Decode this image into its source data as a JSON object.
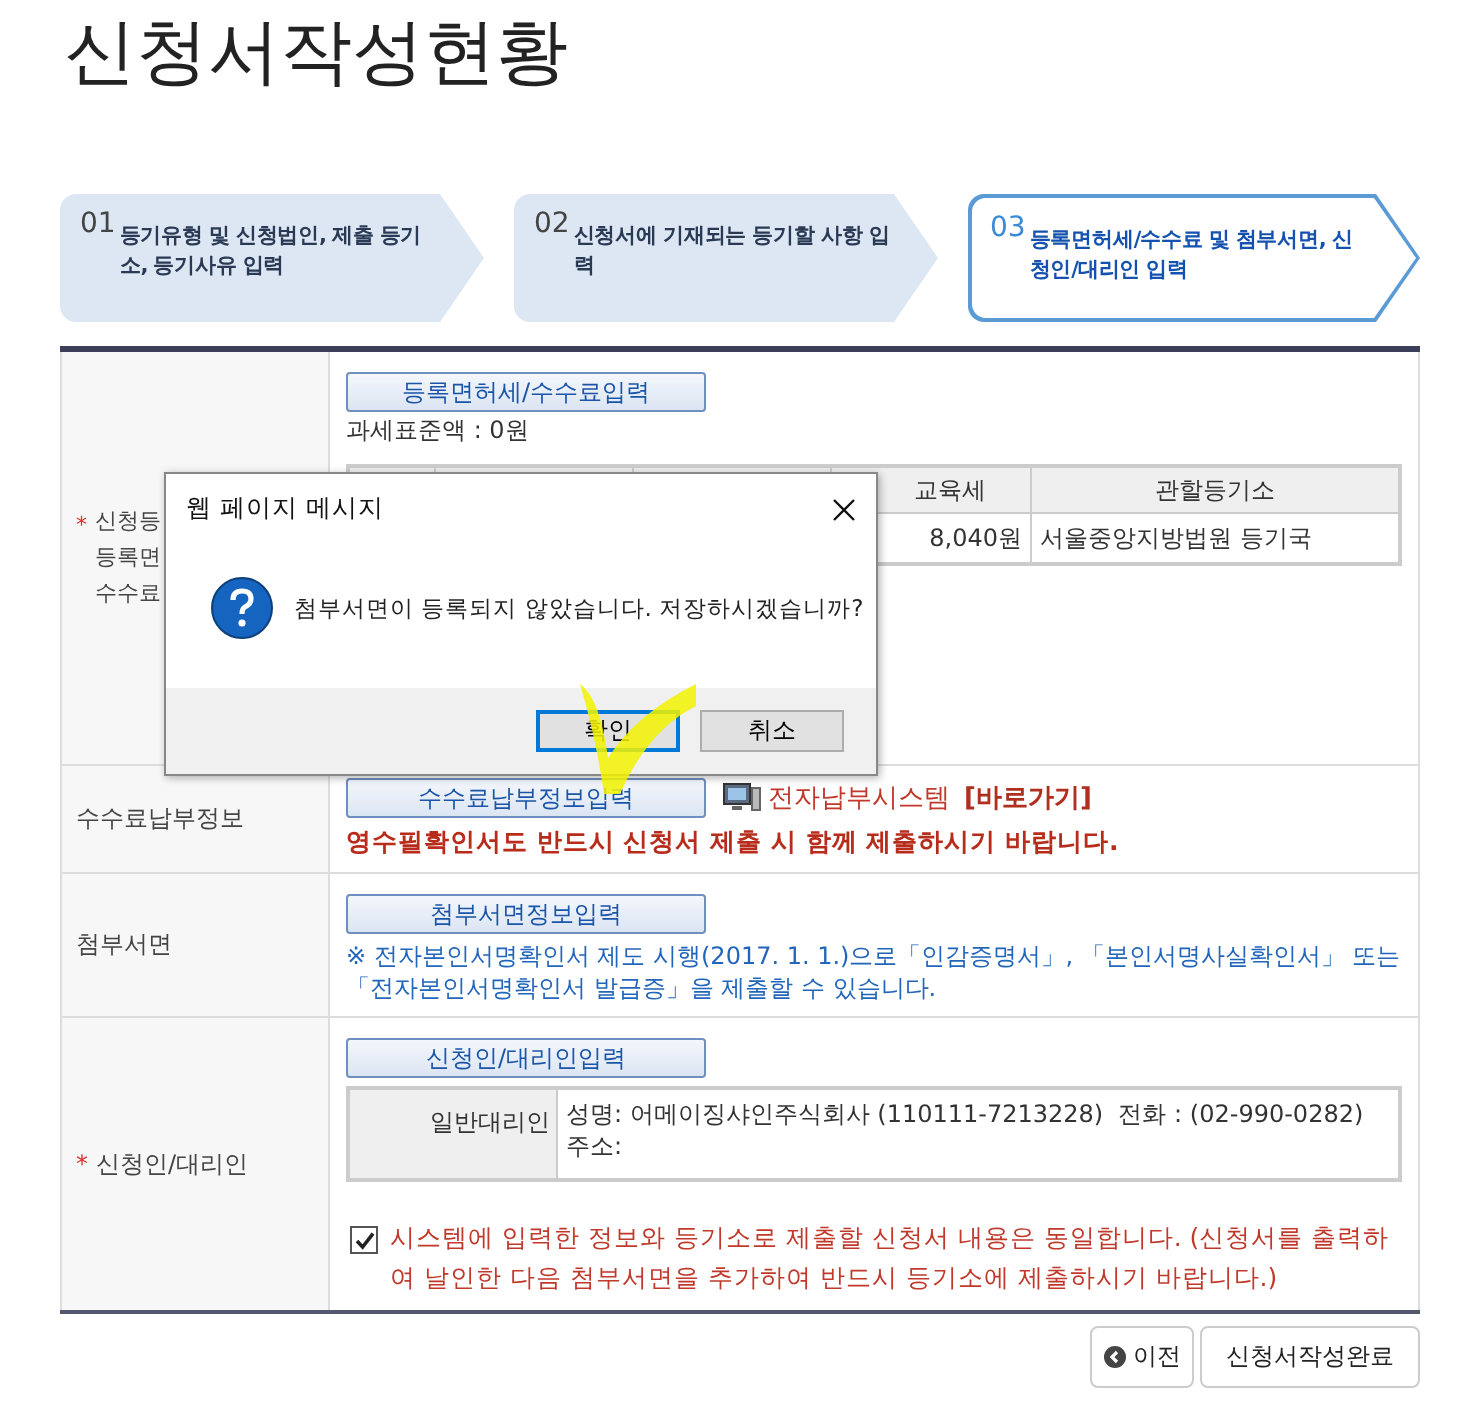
{
  "page_title": "신청서작성현황",
  "steps": [
    {
      "number": "01",
      "label": "등기유형 및 신청법인, 제출 등기소, 등기사유 입력",
      "selected": false
    },
    {
      "number": "02",
      "label": "신청서에 기재되는 등기할 사항 입력",
      "selected": false
    },
    {
      "number": "03",
      "label": "등록면허세/수수료 및 첨부서면, 신청인/대리인 입력",
      "selected": true
    }
  ],
  "sections": [
    {
      "kind": "fee",
      "mark": "*",
      "label_lines": [
        "신청등",
        "등록면",
        "수수료"
      ],
      "button": "등록면허세/수수료입력",
      "tax_base": "과세표준액 : 0원",
      "columns": [
        "교육세",
        "관할등기소"
      ],
      "row": [
        "8,040원",
        "서울중앙지방법원 등기국"
      ]
    },
    {
      "kind": "payment",
      "label": "수수료납부정보",
      "button": "수수료납부정보입력",
      "link": "전자납부시스템",
      "shortcut": "[바로가기]",
      "notice": "영수필확인서도 반드시 신청서 제출 시 함께 제출하시기 바랍니다."
    },
    {
      "kind": "attachment",
      "label": "첨부서면",
      "button": "첨부서면정보입력",
      "note": "※ 전자본인서명확인서 제도 시행(2017. 1. 1.)으로「인감증명서」, 「본인서명사실확인서」 또는 「전자본인서명확인서 발급증」을 제출할 수 있습니다."
    },
    {
      "kind": "applicant",
      "mark": "*",
      "label": "신청인/대리인",
      "button": "신청인/대리인입력",
      "agent_type": "일반대리인",
      "agent_lines": [
        "성명: 어메이징샤인주식회사 (110111-7213228)  전화 : (02-990-0282)",
        "주소:"
      ],
      "confirm_checked": true,
      "confirm_text": "시스템에 입력한 정보와 등기소로 제출할 신청서 내용은 동일합니다. (신청서를 출력하여 날인한 다음 첨부서면을 추가하여 반드시 등기소에 제출하시기 바랍니다.)"
    }
  ],
  "footer_buttons": [
    {
      "kind": "back",
      "label": "이전"
    },
    {
      "kind": "complete",
      "label": "신청서작성완료"
    }
  ],
  "dialog": {
    "title": "웹 페이지 메시지",
    "message": "첨부서면이 등록되지 않았습니다. 저장하시겠습니까?",
    "buttons": [
      {
        "label": "확인",
        "selected": true
      },
      {
        "label": "취소",
        "selected": false
      }
    ]
  }
}
